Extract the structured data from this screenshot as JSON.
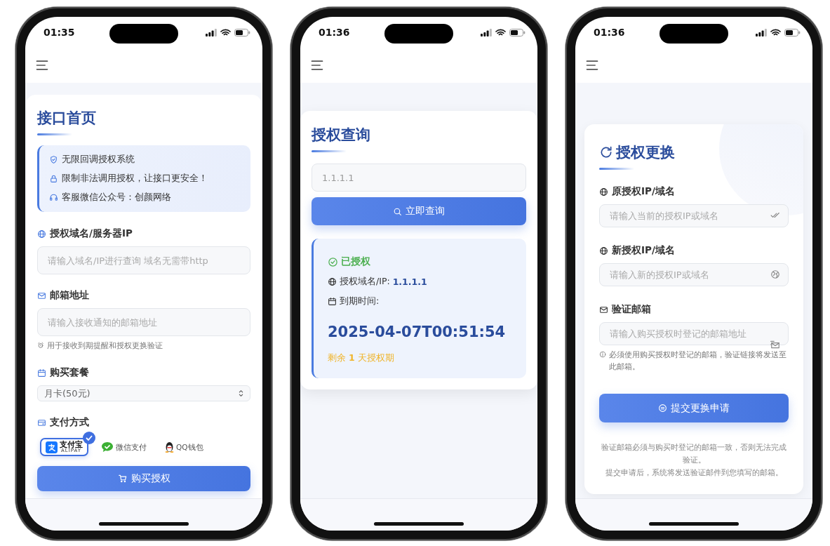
{
  "phones": [
    {
      "kind": "home",
      "time": "01:35",
      "title": "接口首页",
      "notices": [
        {
          "text": "无限回调授权系统"
        },
        {
          "text": "限制非法调用授权，让接口更安全！"
        },
        {
          "text": "客服微信公众号：创颜网络"
        }
      ],
      "fields": [
        {
          "kind": "input",
          "label": "授权域名/服务器IP",
          "placeholder": "请输入域名/IP进行查询 域名无需带http"
        },
        {
          "kind": "input",
          "label": "邮箱地址",
          "placeholder": "请输入接收通知的邮箱地址",
          "hint": "用于接收到期提醒和授权更换验证"
        },
        {
          "kind": "select",
          "label": "购买套餐",
          "value": "月卡(50元)"
        },
        {
          "kind": "payment",
          "label": "支付方式",
          "options": [
            {
              "kind": "alipay",
              "label": "支付宝",
              "sublabel": "ALIPAY",
              "selected": true
            },
            {
              "kind": "wechat",
              "label": "微信支付",
              "selected": false
            },
            {
              "kind": "qq",
              "label": "QQ钱包",
              "selected": false
            }
          ]
        }
      ],
      "button": "购买授权"
    },
    {
      "kind": "query",
      "time": "01:36",
      "title": "授权查询",
      "query_value": "1.1.1.1",
      "button": "立即查询",
      "result": {
        "status": "已授权",
        "domain_label": "授权域名/IP:",
        "domain_value": "1.1.1.1",
        "expiry_label": "到期时间:",
        "expiry": "2025-04-07T00:51:54",
        "remaining": "剩余 **1** 天授权期"
      }
    },
    {
      "kind": "change",
      "time": "01:36",
      "title": "授权更换",
      "fields": [
        {
          "kind": "input",
          "label": "原授权IP/域名",
          "placeholder": "请输入当前的授权IP或域名"
        },
        {
          "kind": "input",
          "label": "新授权IP/域名",
          "placeholder": "请输入新的授权IP或域名"
        },
        {
          "kind": "input",
          "label": "验证邮箱",
          "placeholder": "请输入购买授权时登记的邮箱地址",
          "hint": "必须使用购买授权时登记的邮箱，验证链接将发送至此邮箱。"
        }
      ],
      "button": "提交更换申请",
      "notes": [
        "验证邮箱必须与购买时登记的邮箱一致，否则无法完成验证。",
        "提交申请后，系统将发送验证邮件到您填写的邮箱。"
      ]
    }
  ]
}
